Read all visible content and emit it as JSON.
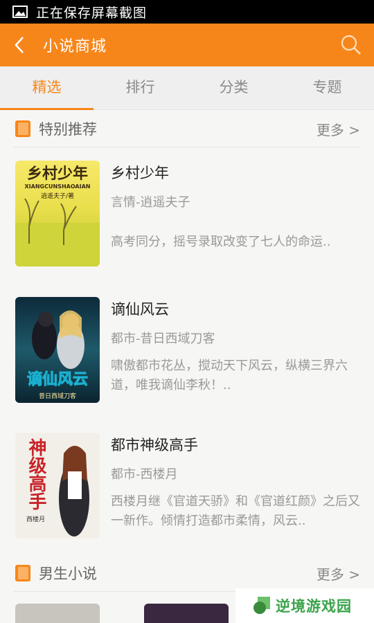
{
  "status_bar": {
    "text": "正在保存屏幕截图",
    "icon": "image-icon"
  },
  "app_bar": {
    "title": "小说商城",
    "back_icon": "back-arrow-icon",
    "search_icon": "search-icon",
    "color": "#f7861a"
  },
  "tabs": [
    {
      "label": "精选",
      "active": true
    },
    {
      "label": "排行",
      "active": false
    },
    {
      "label": "分类",
      "active": false
    },
    {
      "label": "专题",
      "active": false
    }
  ],
  "sections": [
    {
      "title": "特别推荐",
      "more": "更多 >",
      "books": [
        {
          "title": "乡村少年",
          "meta": "言情-逍遥夫子",
          "desc": "高考同分，摇号录取改变了七人的命运.."
        },
        {
          "title": "谪仙风云",
          "meta": "都市-昔日西域刀客",
          "desc": "啸傲都市花丛，搅动天下风云，纵横三界六道，唯我谪仙李秋！.."
        },
        {
          "title": "都市神级高手",
          "meta": "都市-西楼月",
          "desc": "西楼月继《官道天骄》和《官道红颜》之后又一新作。倾情打造都市柔情，风云.."
        }
      ]
    },
    {
      "title": "男生小说",
      "more": "更多 >"
    }
  ],
  "covers": {
    "book1_title": "乡村少年",
    "book1_pinyin": "XIANGCUNSHAOAIAN",
    "book1_author": "逍遥夫子/著",
    "book2_title": "谪仙风云",
    "book2_author": "昔日西域刀客",
    "book3_title": "神级高手",
    "book3_author": "西楼月"
  },
  "watermark": {
    "text": "逆境游戏园"
  }
}
